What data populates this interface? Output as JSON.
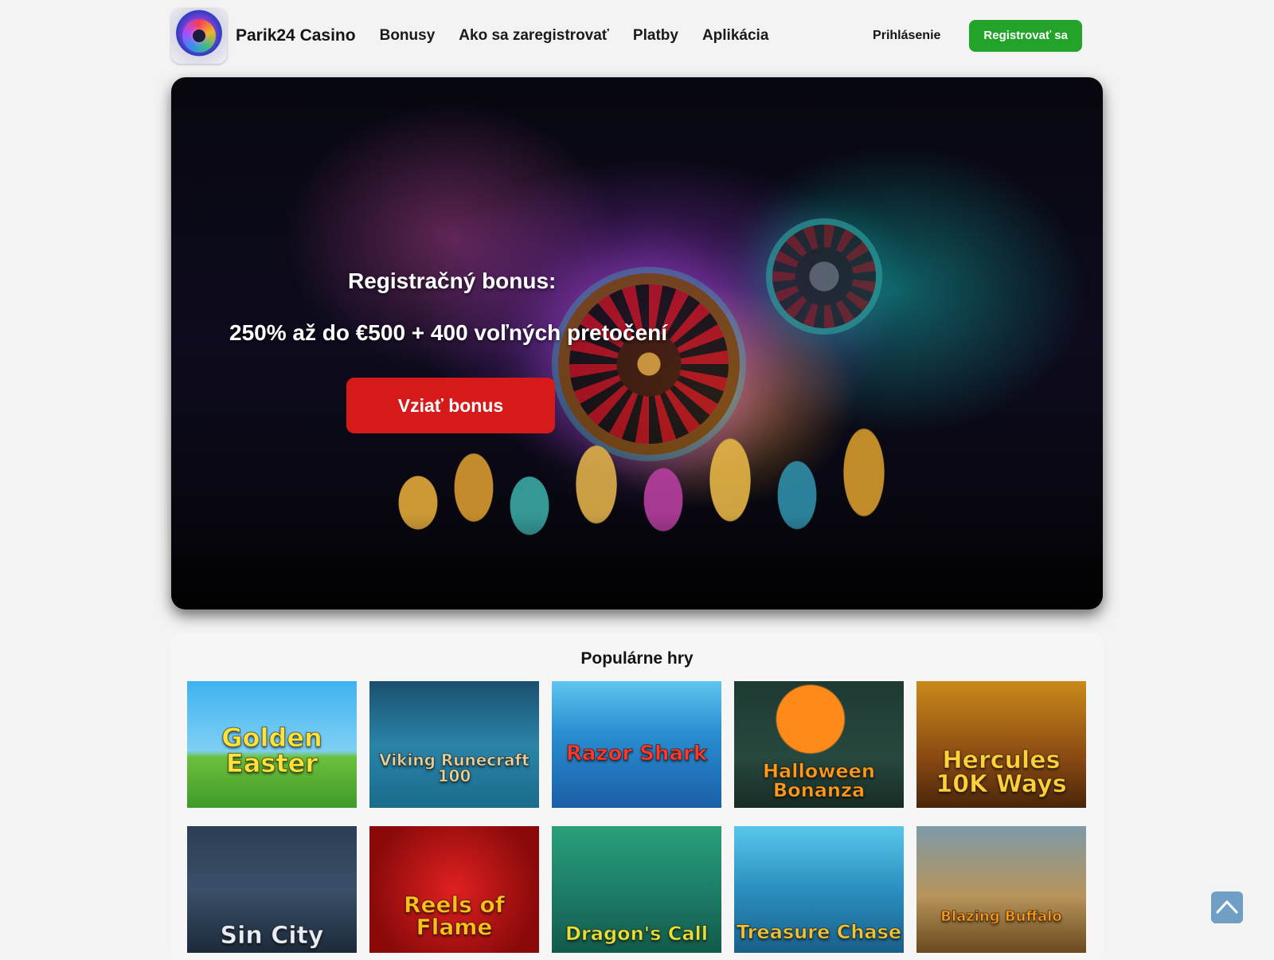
{
  "header": {
    "brand": "Parik24 Casino",
    "nav": [
      "Bonusy",
      "Ako sa zaregistrovať",
      "Platby",
      "Aplikácia"
    ],
    "login": "Prihlásenie",
    "register": "Registrovať sa"
  },
  "hero": {
    "title": "Registračný bonus:",
    "subtitle": "250% až do €500 + 400 voľných pretočení",
    "button": "Vziať bonus"
  },
  "games": {
    "title": "Populárne hry",
    "items": [
      "Golden Easter",
      "Viking Runecraft 100",
      "Razor Shark",
      "Halloween Bonanza",
      "Hercules 10K Ways",
      "Sin City",
      "Reels of Flame",
      "Dragon's Call",
      "Treasure Chase",
      "Blazing Buffalo"
    ]
  },
  "icons": {
    "back_to_top": "chevron-up-icon",
    "logo": "casino-logo-icon"
  },
  "colors": {
    "register_button": "#23a32a",
    "bonus_button": "#d61a1a",
    "back_to_top": "#6f9fc4"
  }
}
